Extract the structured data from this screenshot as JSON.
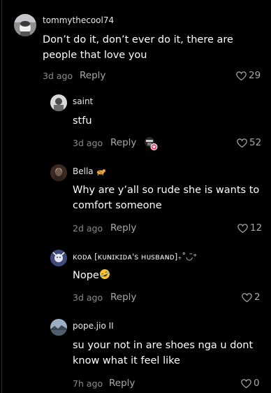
{
  "comments": [
    {
      "username": "tommythecool74",
      "text": "Don’t do it, don’t ever do it, there are people that love you",
      "time": "3d ago",
      "reply_label": "Reply",
      "likes": "29",
      "avatar_icon": "avatar-photo-icon"
    }
  ],
  "replies": [
    {
      "username": "saint",
      "text": "stfu",
      "time": "3d ago",
      "reply_label": "Reply",
      "likes": "52",
      "avatar_icon": "avatar-photo-icon"
    },
    {
      "username": "Bella",
      "username_emoji_icon": "leopard-emoji-icon",
      "text": "Why are y’all so rude she is wants to comfort someone",
      "time": "2d ago",
      "reply_label": "Reply",
      "likes": "12",
      "avatar_icon": "avatar-photo-icon"
    },
    {
      "username": "ᴋᴏᴅᴀ [ᴋᴜɴɪᴋɪᴅᴀ's ʜᴜsʙᴀɴᴅ]₊˚◡̈⁺",
      "text": "Nope",
      "text_emoji_icon": "rolling-on-floor-laughing-emoji-icon",
      "time": "3d ago",
      "reply_label": "Reply",
      "likes": "2",
      "avatar_icon": "avatar-photo-icon"
    },
    {
      "username": "pope.jio II",
      "text": "su your not in are shoes nga u dont know what it feel like",
      "time": "7h ago",
      "reply_label": "Reply",
      "likes": "0",
      "avatar_icon": "avatar-photo-icon"
    }
  ],
  "colors": {
    "background": "#000000",
    "text": "#ffffff",
    "muted": "#8a8a8a",
    "liked_by_creator_badge": "#fe2c55"
  }
}
